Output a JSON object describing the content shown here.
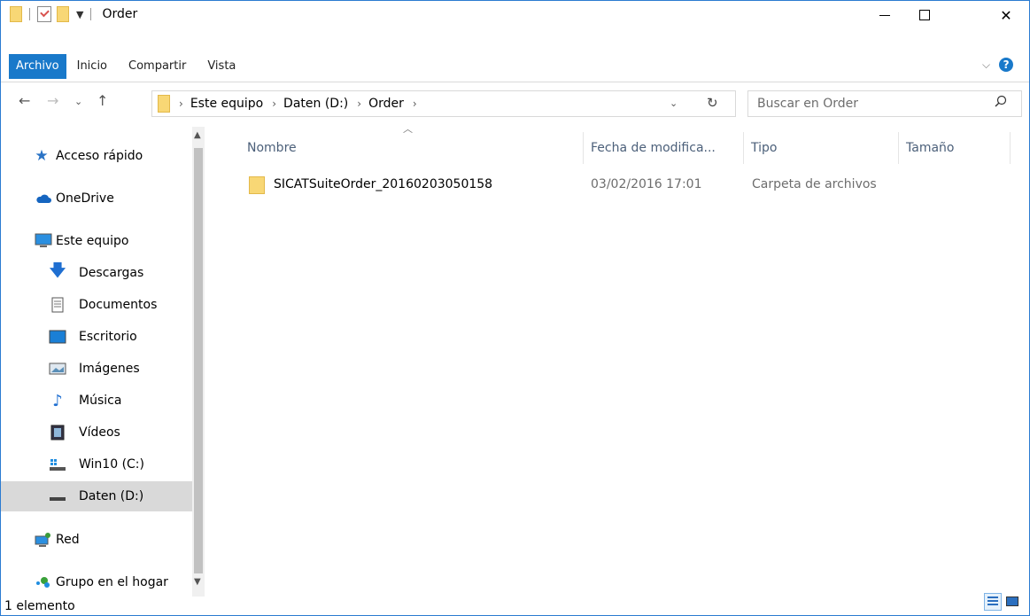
{
  "window": {
    "title": "Order",
    "controls": {
      "minimize_icon": "minimize-icon",
      "maximize_icon": "maximize-icon",
      "close_icon": "close-icon"
    }
  },
  "ribbon": {
    "tabs": [
      {
        "label": "Archivo"
      },
      {
        "label": "Inicio"
      },
      {
        "label": "Compartir"
      },
      {
        "label": "Vista"
      }
    ]
  },
  "address_bar": {
    "crumbs": [
      "Este equipo",
      "Daten (D:)",
      "Order"
    ]
  },
  "search": {
    "placeholder": "Buscar en Order"
  },
  "nav_pane": {
    "items": [
      {
        "label": "Acceso rápido",
        "icon": "star-icon"
      },
      {
        "label": "OneDrive",
        "icon": "cloud-icon"
      },
      {
        "label": "Este equipo",
        "icon": "computer-icon"
      },
      {
        "label": "Descargas",
        "icon": "download-icon"
      },
      {
        "label": "Documentos",
        "icon": "document-icon"
      },
      {
        "label": "Escritorio",
        "icon": "desktop-icon"
      },
      {
        "label": "Imágenes",
        "icon": "pictures-icon"
      },
      {
        "label": "Música",
        "icon": "music-icon"
      },
      {
        "label": "Vídeos",
        "icon": "video-icon"
      },
      {
        "label": "Win10 (C:)",
        "icon": "system-drive-icon"
      },
      {
        "label": "Daten (D:)",
        "icon": "drive-icon",
        "selected": true
      },
      {
        "label": "Red",
        "icon": "network-icon"
      },
      {
        "label": "Grupo en el hogar",
        "icon": "homegroup-icon"
      }
    ]
  },
  "file_list": {
    "columns": [
      "Nombre",
      "Fecha de modifica...",
      "Tipo",
      "Tamaño"
    ],
    "rows": [
      {
        "name": "SICATSuiteOrder_20160203050158",
        "modified": "03/02/2016 17:01",
        "type": "Carpeta de archivos",
        "size": ""
      }
    ]
  },
  "status_bar": {
    "text": "1 elemento"
  },
  "colors": {
    "accent": "#1979ca",
    "folder": "#f8d775",
    "selected": "#d9d9d9",
    "header_text": "#4c607a"
  }
}
